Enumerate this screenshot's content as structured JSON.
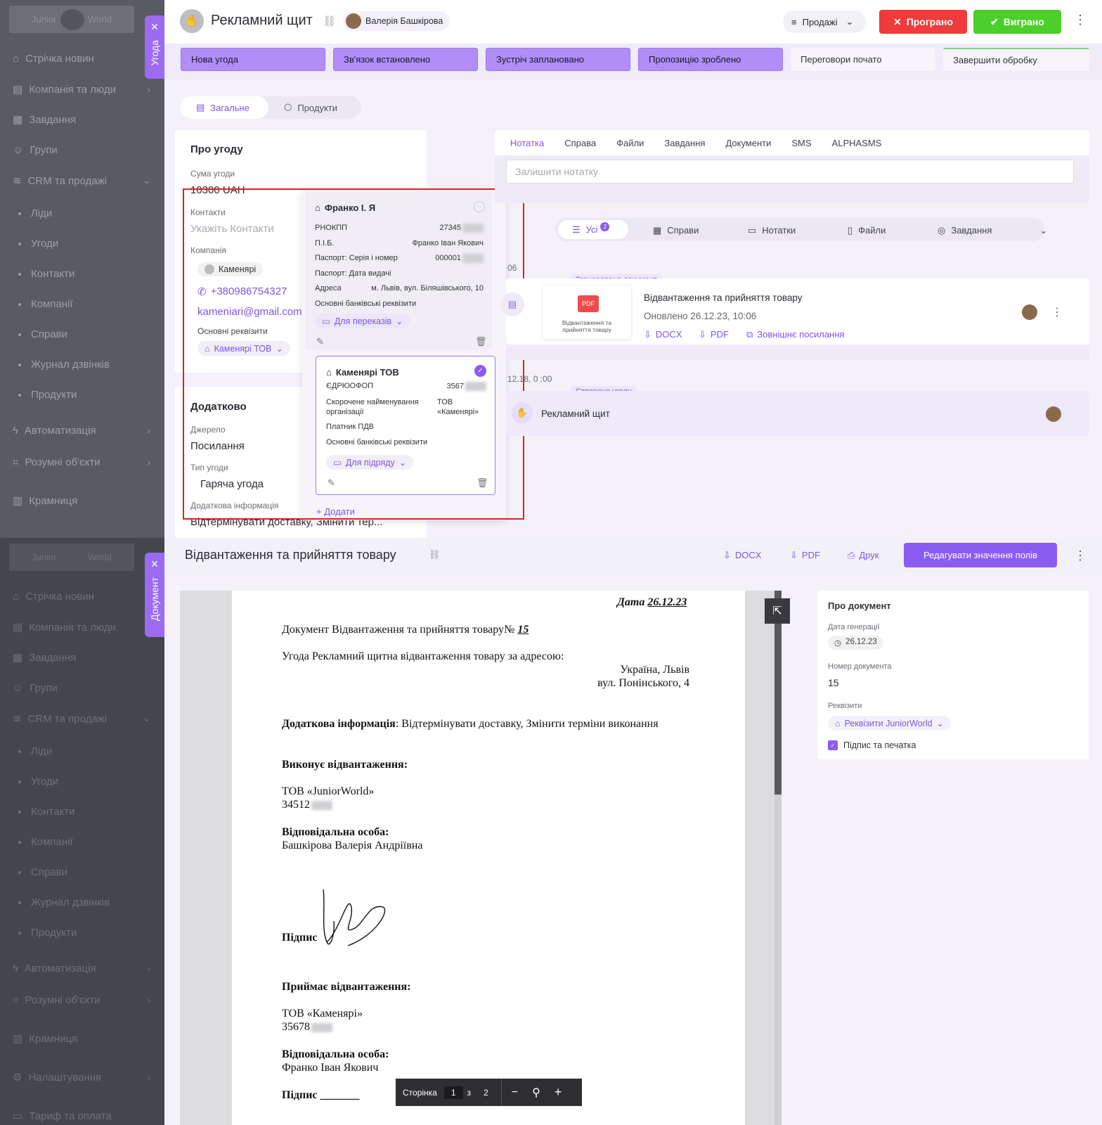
{
  "sidebar": {
    "logo_left": "Junior",
    "logo_right": "World",
    "items": [
      {
        "label": "Стрічка новин"
      },
      {
        "label": "Компанія та люди"
      },
      {
        "label": "Завдання"
      },
      {
        "label": "Групи"
      },
      {
        "label": "CRM та продажі"
      },
      {
        "label": "Автоматизація"
      },
      {
        "label": "Розумні об'єкти"
      },
      {
        "label": "Крамниця"
      },
      {
        "label": "Налаштування"
      },
      {
        "label": "Тариф та оплата"
      }
    ],
    "sub": [
      "Ліди",
      "Угоди",
      "Контакти",
      "Компанії",
      "Справи",
      "Журнал дзвінків",
      "Продукти"
    ]
  },
  "tabs": {
    "deal": "Угода",
    "document": "Документ"
  },
  "deal": {
    "title": "Рекламний щит",
    "owner": "Валерія Башкірова",
    "pipeline": "Продажі",
    "lost_label": "Програно",
    "won_label": "Виграно",
    "stages": [
      "Нова угода",
      "Зв'язок встановлено",
      "Зустріч заплановано",
      "Пропозицію зроблено",
      "Переговори почато",
      "Завершити обробку"
    ],
    "subtabs": [
      "Загальне",
      "Продукти"
    ]
  },
  "about": {
    "title": "Про угоду",
    "sum_label": "Сума угоди",
    "sum_value": "10300 UAH",
    "contacts_label": "Контакти",
    "contacts_placeholder": "Укажіть Контакти",
    "company_label": "Компанія",
    "company_name": "Каменярі",
    "phone": "+380986754327",
    "email": "kameniari@gmail.com",
    "req_label": "Основні реквізити",
    "req_value": "Каменярі ТОВ"
  },
  "extra": {
    "title": "Додатково",
    "source_label": "Джерело",
    "source_value": "Посилання",
    "type_label": "Тип угоди",
    "type_value": "Гаряча угода",
    "info_label": "Додаткова інформація",
    "info_value": "Відтермінувати доставку, Змінити тер..."
  },
  "popover": {
    "r1": {
      "name": "Франко І. Я",
      "f1l": "РНОКПП",
      "f1v": "27345",
      "f2l": "П.І.Б.",
      "f2v": "Франко Іван Якович",
      "f3l": "Паспорт: Серія і номер",
      "f3v": "000001",
      "f4l": "Паспорт: Дата видачі",
      "f5l": "Адреса",
      "f5v": "м. Львів, вул. Біляшівського, 10",
      "f6l": "Основні банківські реквізити",
      "bank": "Для переказів"
    },
    "r2": {
      "name": "Каменярі ТОВ",
      "f1l": "ЄДРЮОФОП",
      "f1v": "3567",
      "f2l": "Скорочене найменування організації",
      "f2v": "ТОВ «Каменярі»",
      "f3l": "Платник ПДВ",
      "f4l": "Основні банківські реквізити",
      "bank": "Для підряду"
    },
    "add": "Додати"
  },
  "activity": {
    "tabs": [
      "Нотатка",
      "Справа",
      "Файли",
      "Завдання",
      "Документи",
      "SMS",
      "ALPHASMS"
    ],
    "note_placeholder": "Залишити нотатку",
    "filters": [
      "Усі",
      "Справи",
      "Нотатки",
      "Файли",
      "Завдання"
    ],
    "all_badge": "2",
    "date1": "06",
    "tag1": "Згенеровано документ",
    "doc_title": "Відвантаження та прийняття товару",
    "doc_updated": "Оновлено 26.12.23, 10:06",
    "thumb_badge": "PDF",
    "thumb_caption": "Відвантаження та прийняття товару",
    "docx": "DOCX",
    "pdf": "PDF",
    "external": "Зовнішнє посилання",
    "date2": "12.18, 0 :00",
    "tag2": "Створено угоду",
    "deal_created": "Рекламний щит"
  },
  "document": {
    "title": "Відвантаження та прийняття товару",
    "docx": "DOCX",
    "pdf": "PDF",
    "print": "Друк",
    "edit": "Редагувати значення полів",
    "date_prefix": "Дата",
    "date": "26.12.23",
    "line1": "Документ Відвантаження та прийняття товару№",
    "num": "15",
    "line2": "Угода Рекламний щитна відвантаження товару за адресою:",
    "addr1": "Україна, Львів",
    "addr2": "вул. Понінського, 4",
    "extra_bold": "Додаткова інформація",
    "extra_text": ": Відтермінувати доставку, Змінити терміни виконання",
    "exec_h": "Виконує відвантаження:",
    "exec_co": "ТОВ «JuniorWorld»",
    "exec_code": "34512",
    "resp_h": "Відповідальна особа:",
    "resp1": "Башкірова Валерія Андріївна",
    "sign": "Підпис",
    "recv_h": "Приймає відвантаження:",
    "recv_co": "ТОВ «Каменярі»",
    "recv_code": "35678",
    "resp2": "Франко Іван Якович",
    "sign2": "Підпис _______",
    "page_label": "Сторінка",
    "page_cur": "1",
    "page_of": "з",
    "page_total": "2"
  },
  "about_doc": {
    "title": "Про документ",
    "gen_label": "Дата генерації",
    "gen_value": "26.12.23",
    "num_label": "Номер документа",
    "num_value": "15",
    "req_label": "Реквізити",
    "req_value": "Реквізити JuniorWorld",
    "sign_label": "Підпис та печатка"
  },
  "colors": {
    "accent": "#7c55e6",
    "lost": "#ef3b3b",
    "won": "#4ccf2a",
    "highlight": "#e02020"
  }
}
